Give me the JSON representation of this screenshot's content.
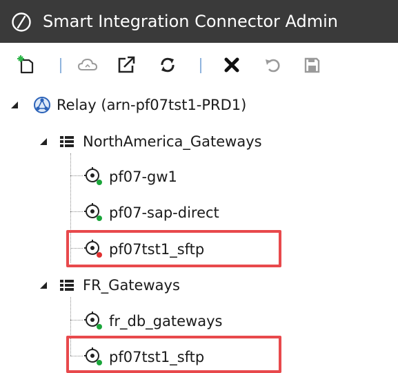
{
  "window": {
    "title": "Smart Integration Connector Admin",
    "logo_icon": "slashed-circle-logo-icon"
  },
  "toolbar": {
    "buttons": [
      {
        "name": "new",
        "icon": "new-document-icon",
        "enabled": true
      },
      {
        "name": "cloud",
        "icon": "cloud-icon",
        "enabled": false
      },
      {
        "name": "open-external",
        "icon": "external-link-icon",
        "enabled": true
      },
      {
        "name": "refresh",
        "icon": "refresh-icon",
        "enabled": true
      },
      {
        "name": "delete",
        "icon": "delete-x-icon",
        "enabled": true
      },
      {
        "name": "undo",
        "icon": "undo-icon",
        "enabled": false
      },
      {
        "name": "save",
        "icon": "save-icon",
        "enabled": false
      }
    ]
  },
  "tree": {
    "relay": {
      "label": "Relay (arn-pf07tst1-PRD1)",
      "icon": "relay-icon",
      "expanded": true
    },
    "groups": [
      {
        "label": "NorthAmerica_Gateways",
        "icon": "gateway-group-icon",
        "expanded": true,
        "items": [
          {
            "label": "pf07-gw1",
            "status": "connected",
            "highlighted": false
          },
          {
            "label": "pf07-sap-direct",
            "status": "connected",
            "highlighted": false
          },
          {
            "label": "pf07tst1_sftp",
            "status": "disconnected",
            "highlighted": true
          }
        ]
      },
      {
        "label": "FR_Gateways",
        "icon": "gateway-group-icon",
        "expanded": true,
        "items": [
          {
            "label": "fr_db_gateways",
            "status": "connected",
            "highlighted": false
          },
          {
            "label": "pf07tst1_sftp",
            "status": "connected",
            "highlighted": true
          }
        ]
      }
    ]
  },
  "colors": {
    "titlebar_bg": "#3a3a3a",
    "status_connected": "#1aa53a",
    "status_disconnected": "#e03030",
    "highlight_border": "#e8494c",
    "separator": "#8fb4dd"
  }
}
